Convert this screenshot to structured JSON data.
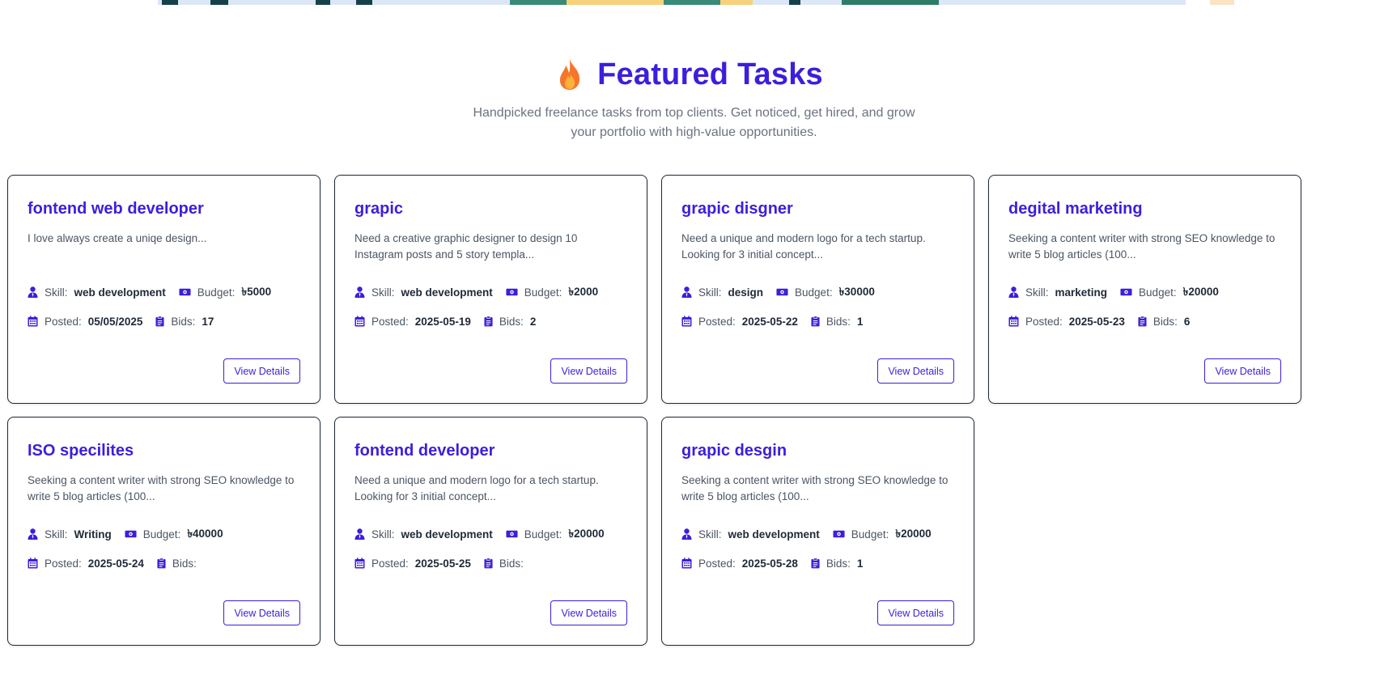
{
  "header": {
    "title": "Featured Tasks",
    "subtitle": "Handpicked freelance tasks from top clients. Get noticed, get hired, and grow your portfolio with high-value opportunities."
  },
  "labels": {
    "skill": "Skill:",
    "budget": "Budget:",
    "posted": "Posted:",
    "bids": "Bids:",
    "view_details": "View Details"
  },
  "colors": {
    "accent": "#3b1fdc",
    "border": "#1f2937",
    "muted": "#6b7280"
  },
  "icons": {
    "title": "fire-icon",
    "skill": "user-tie-icon",
    "budget": "money-bill-icon",
    "posted": "calendar-icon",
    "bids": "clipboard-icon"
  },
  "tasks": [
    {
      "title": "fontend web developer",
      "description": "I love always create a uniqe design...",
      "skill": "web development",
      "budget": "৳5000",
      "posted": "05/05/2025",
      "bids": "17"
    },
    {
      "title": "grapic",
      "description": "Need a creative graphic designer to design 10 Instagram posts and 5 story templa...",
      "skill": "web development",
      "budget": "৳2000",
      "posted": "2025-05-19",
      "bids": "2"
    },
    {
      "title": "grapic disgner",
      "description": "Need a unique and modern logo for a tech startup. Looking for 3 initial concept...",
      "skill": "design",
      "budget": "৳30000",
      "posted": "2025-05-22",
      "bids": "1"
    },
    {
      "title": "degital marketing",
      "description": "Seeking a content writer with strong SEO knowledge to write 5 blog articles (100...",
      "skill": "marketing",
      "budget": "৳20000",
      "posted": "2025-05-23",
      "bids": "6"
    },
    {
      "title": "ISO specilites",
      "description": "Seeking a content writer with strong SEO knowledge to write 5 blog articles (100...",
      "skill": "Writing",
      "budget": "৳40000",
      "posted": "2025-05-24",
      "bids": ""
    },
    {
      "title": "fontend developer",
      "description": "Need a unique and modern logo for a tech startup. Looking for 3 initial concept...",
      "skill": "web development",
      "budget": "৳20000",
      "posted": "2025-05-25",
      "bids": ""
    },
    {
      "title": "grapic desgin",
      "description": "Seeking a content writer with strong SEO knowledge to write 5 blog articles (100...",
      "skill": "web development",
      "budget": "৳20000",
      "posted": "2025-05-28",
      "bids": "1"
    }
  ]
}
